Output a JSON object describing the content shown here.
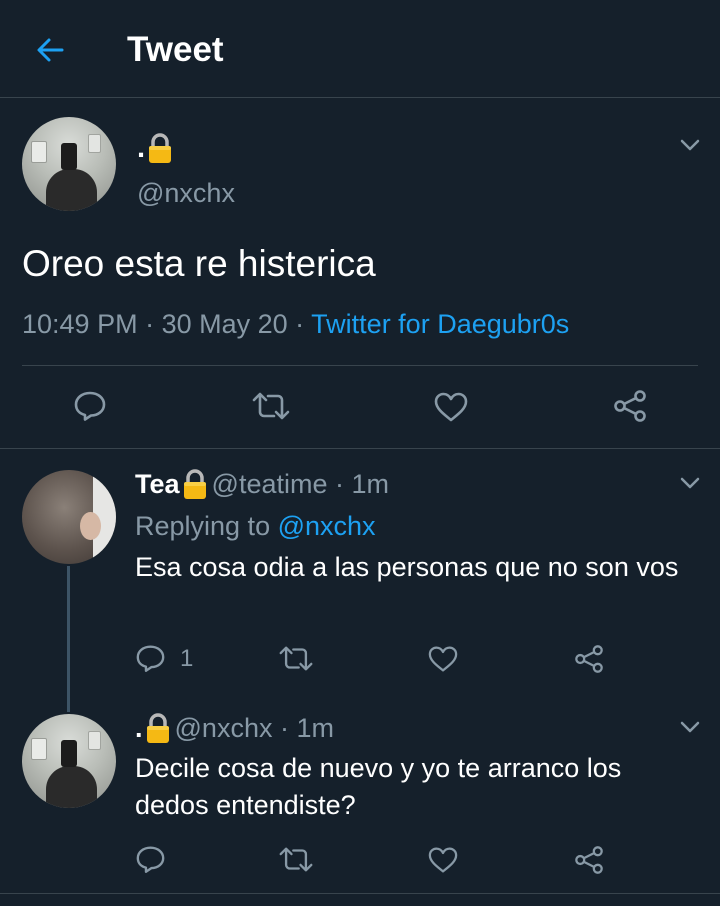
{
  "header": {
    "title": "Tweet"
  },
  "main_tweet": {
    "name": ".",
    "handle": "@nxchx",
    "text": "Oreo esta re histerica",
    "time": "10:49 PM",
    "date": "30 May 20",
    "source": "Twitter for Daegubr0s",
    "separator": " · "
  },
  "replies": [
    {
      "name": "Tea",
      "handle": "@teatime · 1m",
      "replying_prefix": "Replying to ",
      "replying_to": "@nxchx",
      "text": "Esa cosa odia a las personas que no son vos",
      "reply_count": "1"
    },
    {
      "name": ".",
      "handle": "@nxchx · 1m",
      "text": "Decile cosa de nuevo y yo te arranco los dedos entendiste?"
    }
  ],
  "colors": {
    "background": "#15202b",
    "accent": "#1da1f2",
    "secondary_text": "#8899a6",
    "divider": "#38444d"
  },
  "icons": {
    "back": "arrow-left-icon",
    "more": "chevron-down-icon",
    "reply": "speech-bubble-icon",
    "retweet": "retweet-icon",
    "like": "heart-icon",
    "share": "share-icon",
    "locked": "lock-icon"
  }
}
